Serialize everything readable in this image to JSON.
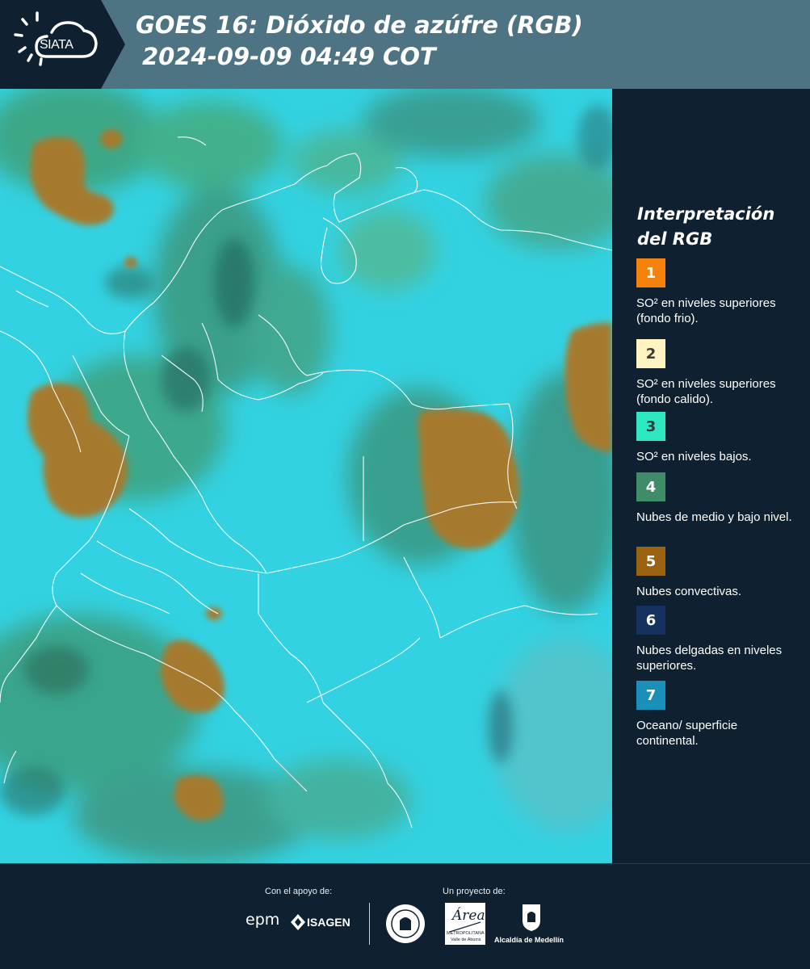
{
  "header": {
    "logo_text": "SIATA",
    "title_line1": "GOES 16: Dióxido de azúfre (RGB)",
    "title_line2": "2024-09-09 04:49 COT"
  },
  "legend": {
    "title_line1": "Interpretación",
    "title_line2": "del RGB",
    "items": [
      {
        "number": "1",
        "color": "#f5820d",
        "text_color": "#ffffff",
        "text": "SO² en niveles superiores (fondo frio)."
      },
      {
        "number": "2",
        "color": "#fdf4c2",
        "text_color": "#3a3a3a",
        "text": "SO² en niveles superiores (fondo calido)."
      },
      {
        "number": "3",
        "color": "#2ee8c2",
        "text_color": "#3a3a3a",
        "text": "SO² en niveles bajos."
      },
      {
        "number": "4",
        "color": "#3f8c69",
        "text_color": "#ffffff",
        "text": "Nubes de medio y bajo nivel."
      },
      {
        "number": "5",
        "color": "#9a6210",
        "text_color": "#ffffff",
        "text": "Nubes convectivas."
      },
      {
        "number": "6",
        "color": "#15325e",
        "text_color": "#ffffff",
        "text": "Nubes delgadas en niveles superiores."
      },
      {
        "number": "7",
        "color": "#1a90b8",
        "text_color": "#ffffff",
        "text": "Oceano/ superficie continental."
      }
    ]
  },
  "footer": {
    "support_label": "Con el apoyo de:",
    "project_label": "Un proyecto de:",
    "logo_epm": "epm",
    "logo_isagen": "ISAGEN",
    "logo_medellin_seal": "MEDELLÍN",
    "logo_area_name": "Área",
    "logo_area_line1": "METROPOLITANA",
    "logo_area_line2": "Valle de Aburrá",
    "logo_alcaldia": "Alcaldía de Medellín"
  },
  "colors": {
    "header_bg": "#4e7484",
    "panel_bg": "#0f2130",
    "map_background": "#2fd3e0",
    "convective_cloud": "#a0782e"
  }
}
